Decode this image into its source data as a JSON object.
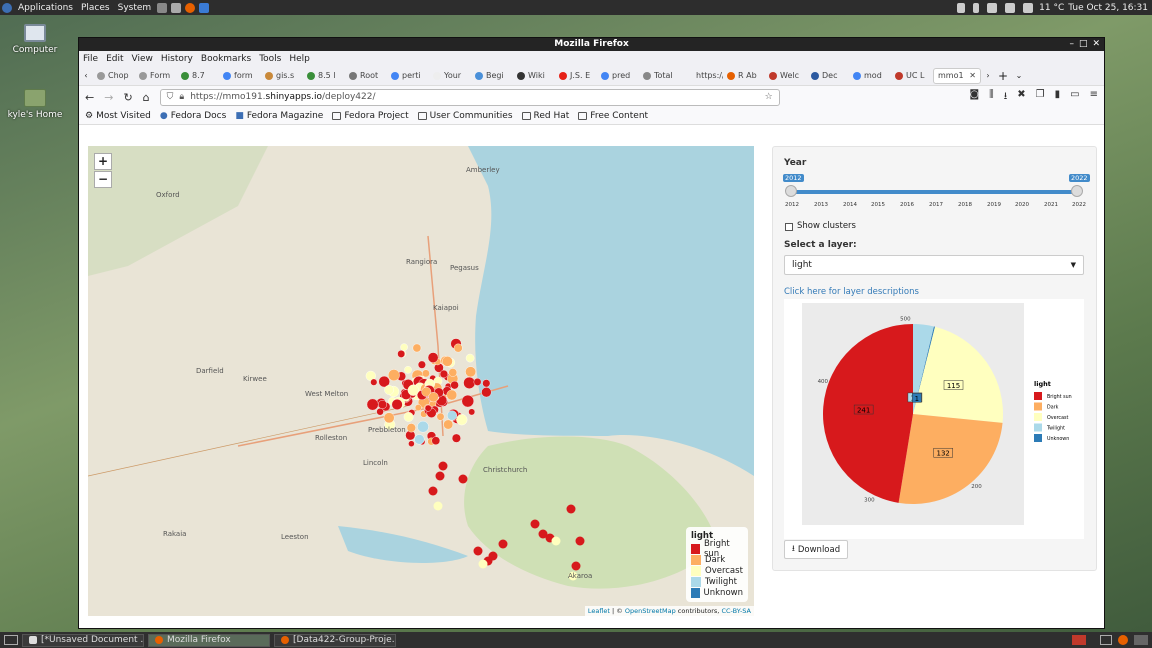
{
  "top_panel": {
    "menus": [
      "Applications",
      "Places",
      "System"
    ],
    "weather": "11 °C",
    "clock": "Tue Oct 25, 16:31"
  },
  "desktop": {
    "icons": [
      "Computer",
      "kyle's Home"
    ]
  },
  "taskbar": {
    "tasks": [
      "[*Unsaved Document ...",
      "Mozilla Firefox",
      "[Data422-Group-Proje..."
    ]
  },
  "window": {
    "title": "Mozilla Firefox"
  },
  "menubar": [
    "File",
    "Edit",
    "View",
    "History",
    "Bookmarks",
    "Tools",
    "Help"
  ],
  "tabs": [
    "Chop",
    "Form",
    "8.7",
    "form",
    "gis.s",
    "8.5 l",
    "Root",
    "perti",
    "Your",
    "Begi",
    "Wiki",
    "J.S. E",
    "pred",
    "Total",
    "https://",
    "R Ab",
    "Welc",
    "Dec",
    "mod",
    "UC L",
    "mmo1"
  ],
  "url": {
    "prefix": "https://mmo191.",
    "host": "shinyapps.io",
    "path": "/deploy422/"
  },
  "bookmarks": [
    "Most Visited",
    "Fedora Docs",
    "Fedora Magazine",
    "Fedora Project",
    "User Communities",
    "Red Hat",
    "Free Content"
  ],
  "map": {
    "zoom_in": "+",
    "zoom_out": "−",
    "place_labels": [
      "Oxford",
      "Rangiora",
      "Pegasus",
      "Kaiapoi",
      "Darfield",
      "Kirwee",
      "West Melton",
      "Rolleston",
      "Prebbleton",
      "Lincoln",
      "Leeston",
      "Amberley",
      "Rakaia",
      "Akaroa",
      "Christchurch"
    ],
    "legend_title": "light",
    "legend": [
      {
        "label": "Bright sun",
        "color": "#d7191c"
      },
      {
        "label": "Dark",
        "color": "#fdae61"
      },
      {
        "label": "Overcast",
        "color": "#ffffbf"
      },
      {
        "label": "Twilight",
        "color": "#abd9e9"
      },
      {
        "label": "Unknown",
        "color": "#2c7bb6"
      }
    ],
    "attribution": {
      "leaflet": "Leaflet",
      "sep": " | © ",
      "osm": "OpenStreetMap",
      "contrib": " contributors, ",
      "license": "CC-BY-SA"
    }
  },
  "panel": {
    "year_label": "Year",
    "year_min": "2012",
    "year_max": "2022",
    "year_range": [
      2012,
      2022
    ],
    "ticks": [
      "2012",
      "2013",
      "2014",
      "2015",
      "2016",
      "2017",
      "2018",
      "2019",
      "2020",
      "2021",
      "2022"
    ],
    "show_clusters": "Show clusters",
    "layer_label": "Select a layer:",
    "layer_value": "light",
    "layer_link": "Click here for layer descriptions",
    "download": "Download"
  },
  "chart_data": {
    "type": "pie",
    "title": "",
    "legend_title": "light",
    "radial_ticks": [
      "500",
      "400",
      "300",
      "200"
    ],
    "slices": [
      {
        "label": "Bright sun",
        "value": 241,
        "color": "#d7191c"
      },
      {
        "label": "Dark",
        "value": 132,
        "color": "#fdae61"
      },
      {
        "label": "Overcast",
        "value": 115,
        "color": "#ffffbf"
      },
      {
        "label": "Twilight",
        "value": 19,
        "color": "#abd9e9"
      },
      {
        "label": "Unknown",
        "value": 1,
        "color": "#2c7bb6"
      }
    ],
    "legend_placement": "right"
  }
}
